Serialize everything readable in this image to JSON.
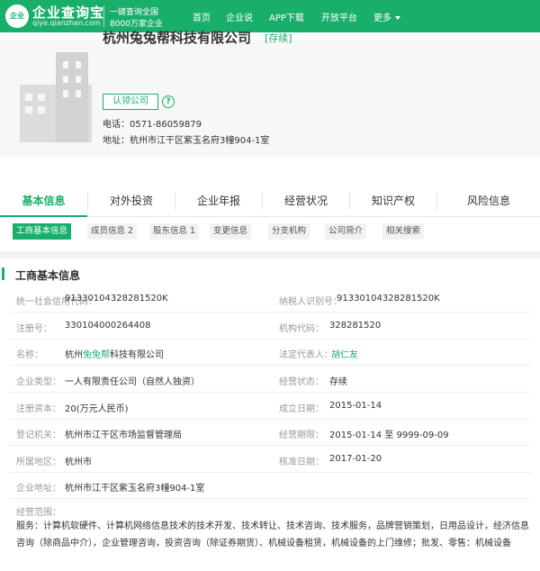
{
  "topbar": {
    "logo_text": "企业",
    "brand": "企业查询宝",
    "brand_url": "qiye.qianzhan.com",
    "slogan_line1": "一键查询全国",
    "slogan_line2": "8000万家企业",
    "nav": [
      "首页",
      "企业说",
      "APP下载",
      "开放平台",
      "更多"
    ],
    "colors": {
      "brand_green": "#1aae6b"
    }
  },
  "company": {
    "name": "杭州兔兔帮科技有限公司",
    "status_tag": "[存续]",
    "claim_button": "认领公司",
    "help_icon": "?",
    "phone_label": "电话：",
    "phone": "0571-86059879",
    "address_label": "地址：",
    "address": "杭州市江干区紫玉名府3幢904-1室"
  },
  "tabs": [
    "基本信息",
    "对外投资",
    "企业年报",
    "经营状况",
    "知识产权",
    "风险信息"
  ],
  "subtabs": [
    "工商基本信息",
    "成员信息 2",
    "股东信息 1",
    "变更信息",
    "分支机构",
    "公司简介",
    "相关搜索"
  ],
  "section": {
    "title": "工商基本信息",
    "rows": [
      {
        "l1": "统一社会信用代码：",
        "v1": "91330104328281520K",
        "l2": "纳税人识别号：",
        "v2": "91330104328281520K"
      },
      {
        "l1": "注册号：",
        "v1": "330104000264408",
        "l2": "机构代码：",
        "v2": "328281520"
      },
      {
        "l1": "名称：",
        "v1_pre": "杭州",
        "v1_hl": "兔兔帮",
        "v1_post": "科技有限公司",
        "l2": "法定代表人：",
        "v2": "胡仁友"
      },
      {
        "l1": "企业类型：",
        "v1": "一人有限责任公司（自然人独资）",
        "l2": "经营状态：",
        "v2": "存续"
      },
      {
        "l1": "注册资本：",
        "v1": "20(万元人民币)",
        "l2": "成立日期：",
        "v2": "2015-01-14"
      },
      {
        "l1": "登记机关：",
        "v1": "杭州市江干区市场监督管理局",
        "l2": "经营期限：",
        "v2": "2015-01-14 至 9999-09-09"
      },
      {
        "l1": "所属地区：",
        "v1": "杭州市",
        "l2": "核准日期：",
        "v2": "2017-01-20"
      },
      {
        "l1": "企业地址：",
        "v1": "杭州市江干区紫玉名府3幢904-1室"
      }
    ],
    "scope_label": "经营范围：",
    "scope": "服务：计算机软硬件、计算机网络信息技术的技术开发、技术转让、技术咨询、技术服务，品牌营销策划，日用品设计，经济信息咨询（除商品中介），企业管理咨询，投资咨询（除证券期货）、机械设备租赁，机械设备的上门维修；批发、零售：机械设备"
  }
}
